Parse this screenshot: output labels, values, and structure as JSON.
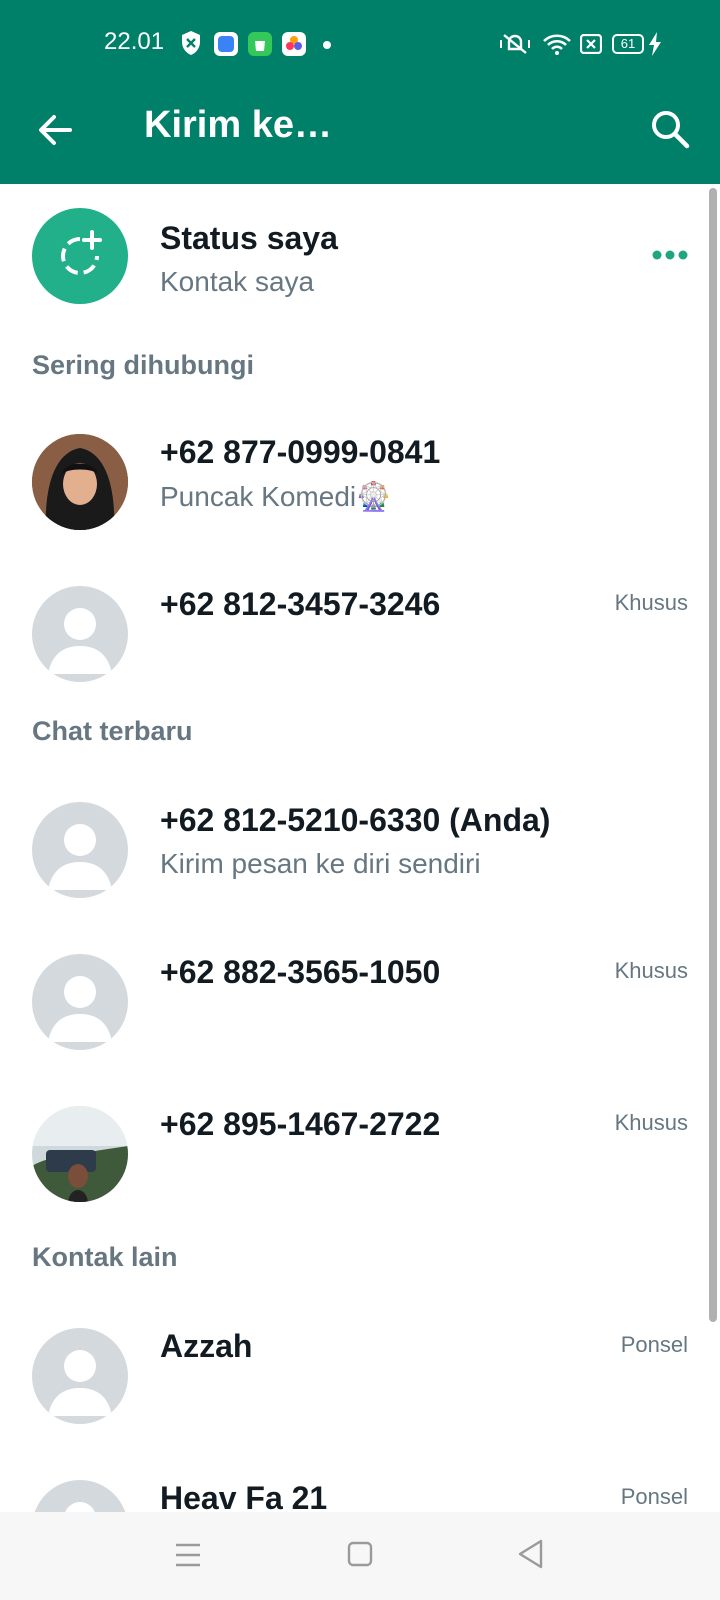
{
  "status_bar": {
    "time": "22.01",
    "battery": "61"
  },
  "app_bar": {
    "title": "Kirim ke…"
  },
  "my_status": {
    "title": "Status saya",
    "subtitle": "Kontak saya"
  },
  "sections": {
    "frequent": "Sering dihubungi",
    "recent": "Chat terbaru",
    "others": "Kontak lain"
  },
  "contacts": [
    {
      "name": "+62 877-0999-0841",
      "subtitle": "Puncak Komedi🎡",
      "tag": ""
    },
    {
      "name": "+62 812-3457-3246",
      "subtitle": "",
      "tag": "Khusus"
    },
    {
      "name": "+62 812-5210-6330 (Anda)",
      "subtitle": "Kirim pesan ke diri sendiri",
      "tag": ""
    },
    {
      "name": "+62 882-3565-1050",
      "subtitle": "",
      "tag": "Khusus"
    },
    {
      "name": "+62 895-1467-2722",
      "subtitle": "",
      "tag": "Khusus"
    },
    {
      "name": "Azzah",
      "subtitle": "",
      "tag": "Ponsel"
    },
    {
      "name": "Heav Fa 21",
      "subtitle": "",
      "tag": "Ponsel"
    }
  ],
  "colors": {
    "header": "#008069",
    "status_avatar": "#21b089",
    "accent_dots": "#1fa57f",
    "placeholder_avatar": "#d4d9de"
  },
  "icons": [
    "back-arrow-icon",
    "search-icon",
    "status-add-icon",
    "more-icon",
    "menu-icon",
    "home-icon",
    "back-triangle-icon"
  ]
}
